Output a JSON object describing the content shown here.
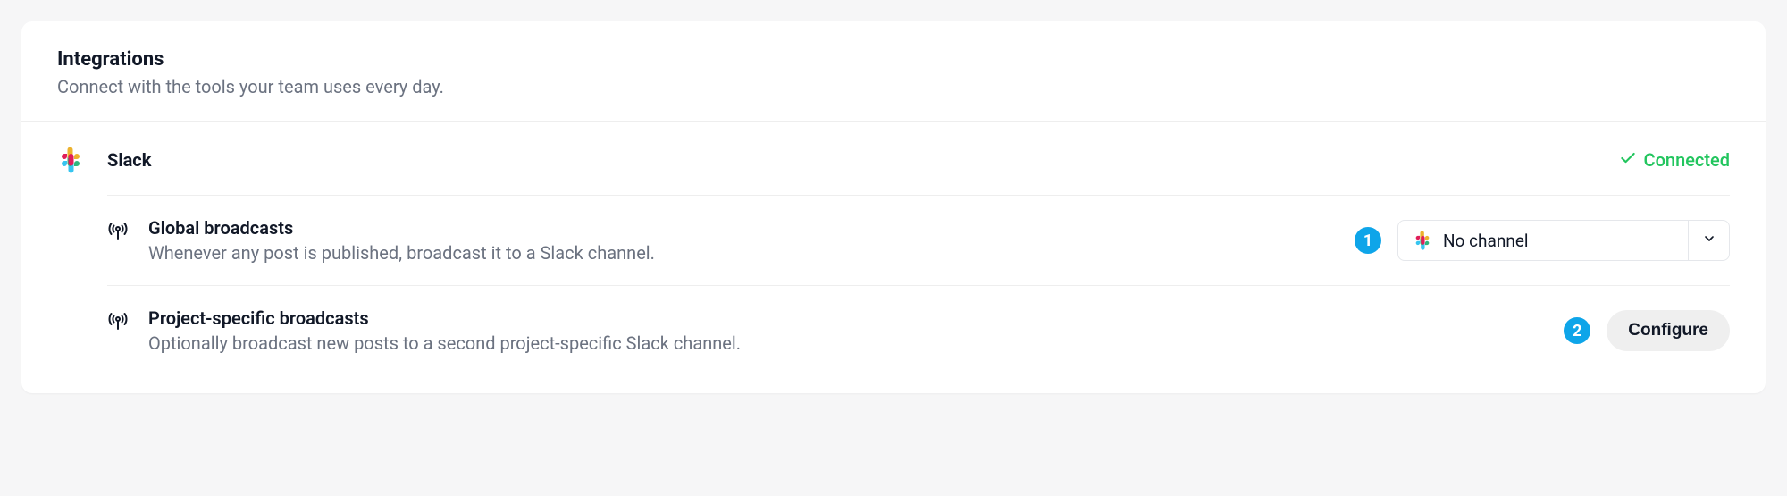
{
  "header": {
    "title": "Integrations",
    "subtitle": "Connect with the tools your team uses every day."
  },
  "integration": {
    "name": "Slack",
    "status": "Connected"
  },
  "settings": {
    "global": {
      "title": "Global broadcasts",
      "description": "Whenever any post is published, broadcast it to a Slack channel.",
      "step": "1",
      "selected": "No channel"
    },
    "project": {
      "title": "Project-specific broadcasts",
      "description": "Optionally broadcast new posts to a second project-specific Slack channel.",
      "step": "2",
      "button": "Configure"
    }
  }
}
